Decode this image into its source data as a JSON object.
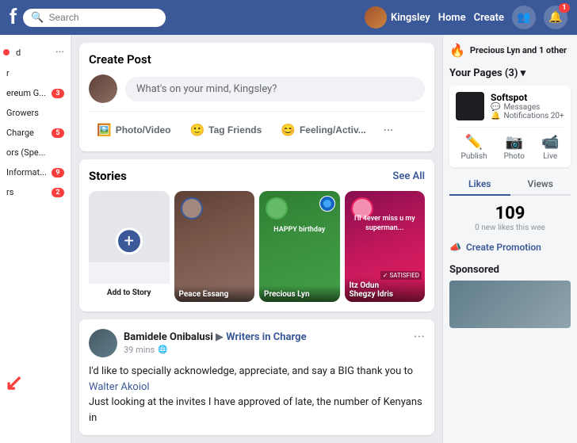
{
  "nav": {
    "logo": "f",
    "search_placeholder": "Search",
    "user_name": "Kingsley",
    "links": [
      "Home",
      "Create"
    ],
    "notification_count": "1"
  },
  "sidebar": {
    "items": [
      {
        "id": "d",
        "label": "d",
        "has_dot": true,
        "has_ellipsis": true
      },
      {
        "id": "r",
        "label": "r",
        "has_dot": false,
        "has_ellipsis": false
      },
      {
        "id": "ereum-g",
        "label": "ereum G...",
        "has_dot": false,
        "has_ellipsis": false,
        "badge": "3"
      },
      {
        "id": "growers",
        "label": "Growers",
        "has_dot": false,
        "has_ellipsis": false
      },
      {
        "id": "charge",
        "label": "Charge",
        "has_dot": false,
        "has_ellipsis": false,
        "badge": "5"
      },
      {
        "id": "ors",
        "label": "ors (Spe...",
        "has_dot": false,
        "has_ellipsis": false
      },
      {
        "id": "informat",
        "label": "Informat...",
        "has_dot": false,
        "has_ellipsis": false,
        "badge": "9"
      },
      {
        "id": "rs",
        "label": "rs",
        "has_dot": false,
        "has_ellipsis": false,
        "badge": "2"
      }
    ]
  },
  "create_post": {
    "title": "Create Post",
    "placeholder": "What's on your mind, Kingsley?",
    "actions": [
      {
        "id": "photo-video",
        "label": "Photo/Video",
        "icon": "🖼️"
      },
      {
        "id": "tag-friends",
        "label": "Tag Friends",
        "icon": "🙂"
      },
      {
        "id": "feeling",
        "label": "Feeling/Activ...",
        "icon": "😊"
      }
    ]
  },
  "stories": {
    "title": "Stories",
    "see_all": "See All",
    "cards": [
      {
        "id": "add-story",
        "name": "Add to Story",
        "type": "add"
      },
      {
        "id": "peace-essang",
        "name": "Peace Essang",
        "type": "person",
        "color": "brown"
      },
      {
        "id": "precious-lyn",
        "name": "Precious Lyn",
        "type": "person",
        "color": "green"
      },
      {
        "id": "itz-odun",
        "name": "Itz Odun\nShegzy Idris",
        "type": "person",
        "color": "pink"
      }
    ]
  },
  "feed_post": {
    "author": "Bamidele Onibalusi",
    "shared_to": "Writers in Charge",
    "time": "39 mins",
    "more_icon": "···",
    "body_line1": "I'd like to specially acknowledge, appreciate, and say a BIG thank you to",
    "body_link": "Walter Akoiol",
    "body_line2": "Just looking at the invites I have approved of late, the number of Kenyans in"
  },
  "right_sidebar": {
    "notification": "Precious Lyn and 1 other",
    "your_pages": "Your Pages (3) ▾",
    "page": {
      "name": "Softspot",
      "messages": "Messages",
      "notifications": "Notifications 20+"
    },
    "page_actions": [
      "Publish",
      "Photo",
      "Live"
    ],
    "tabs": [
      "Likes",
      "Views"
    ],
    "active_tab": "Likes",
    "stat_num": "109",
    "stat_label": "0 new likes this wee",
    "create_promo": "Create Promotion",
    "sponsored": "Sponsored"
  }
}
